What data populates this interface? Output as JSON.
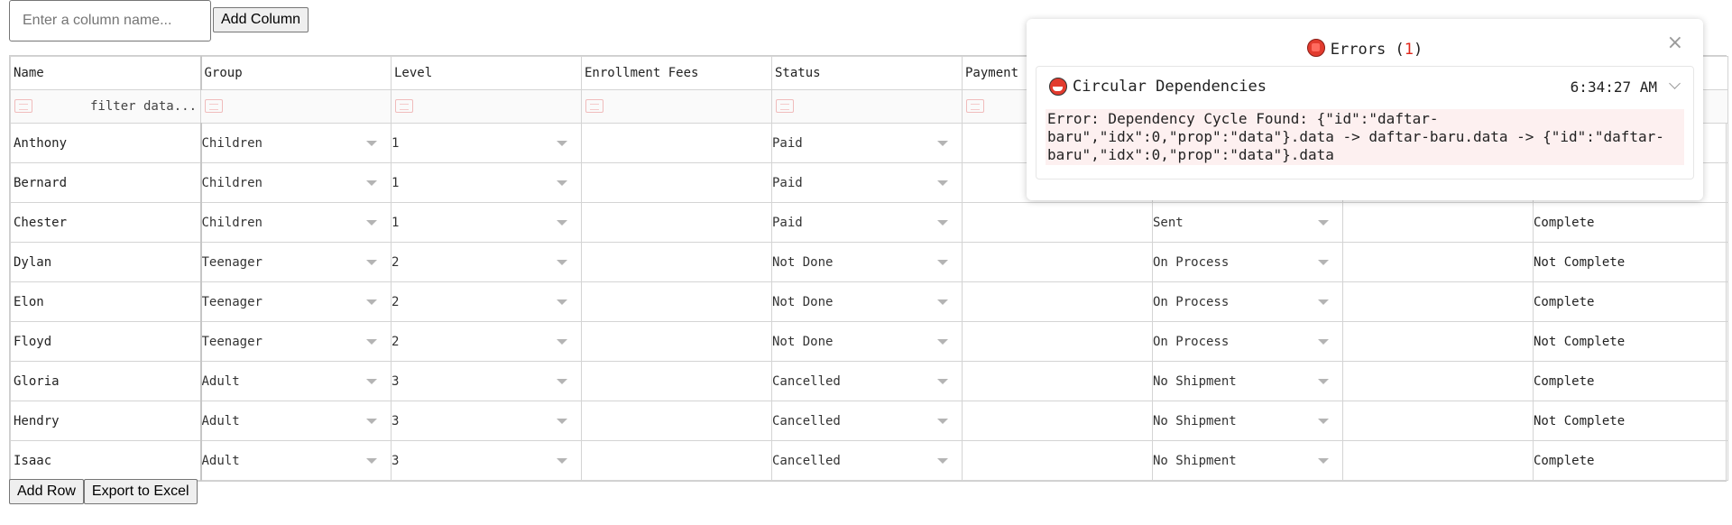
{
  "toolbar": {
    "column_placeholder": "Enter a column name...",
    "add_column_label": "Add Column"
  },
  "grid": {
    "headers": [
      "Name",
      "Group",
      "Level",
      "Enrollment Fees",
      "Status",
      "Payment",
      "",
      "",
      ""
    ],
    "filter_placeholder": "filter data...",
    "rows": [
      {
        "name": "Anthony",
        "group": "Children",
        "level": "1",
        "fees": "",
        "status": "Paid",
        "payment": "",
        "shipment": "",
        "extra": "",
        "result": ""
      },
      {
        "name": "Bernard",
        "group": "Children",
        "level": "1",
        "fees": "",
        "status": "Paid",
        "payment": "",
        "shipment": "",
        "extra": "",
        "result": ""
      },
      {
        "name": "Chester",
        "group": "Children",
        "level": "1",
        "fees": "",
        "status": "Paid",
        "payment": "",
        "shipment": "Sent",
        "extra": "",
        "result": "Complete"
      },
      {
        "name": "Dylan",
        "group": "Teenager",
        "level": "2",
        "fees": "",
        "status": "Not Done",
        "payment": "",
        "shipment": "On Process",
        "extra": "",
        "result": "Not Complete"
      },
      {
        "name": "Elon",
        "group": "Teenager",
        "level": "2",
        "fees": "",
        "status": "Not Done",
        "payment": "",
        "shipment": "On Process",
        "extra": "",
        "result": "Complete"
      },
      {
        "name": "Floyd",
        "group": "Teenager",
        "level": "2",
        "fees": "",
        "status": "Not Done",
        "payment": "",
        "shipment": "On Process",
        "extra": "",
        "result": "Not Complete"
      },
      {
        "name": "Gloria",
        "group": "Adult",
        "level": "3",
        "fees": "",
        "status": "Cancelled",
        "payment": "",
        "shipment": "No Shipment",
        "extra": "",
        "result": "Complete"
      },
      {
        "name": "Hendry",
        "group": "Adult",
        "level": "3",
        "fees": "",
        "status": "Cancelled",
        "payment": "",
        "shipment": "No Shipment",
        "extra": "",
        "result": "Not Complete"
      },
      {
        "name": "Isaac",
        "group": "Adult",
        "level": "3",
        "fees": "",
        "status": "Cancelled",
        "payment": "",
        "shipment": "No Shipment",
        "extra": "",
        "result": "Complete"
      }
    ]
  },
  "footer": {
    "add_row_label": "Add Row",
    "export_label": "Export to Excel"
  },
  "errors": {
    "title": "Errors",
    "count": "1",
    "close_glyph": "×",
    "item": {
      "heading": "Circular Dependencies",
      "time": "6:34:27 AM",
      "message": "Error: Dependency Cycle Found: {\"id\":\"daftar-baru\",\"idx\":0,\"prop\":\"data\"}.data -> daftar-baru.data -> {\"id\":\"daftar-baru\",\"idx\":0,\"prop\":\"data\"}.data"
    }
  },
  "icons": {
    "error_panel_icon": "stop-icon",
    "error_item_icon": "warning-icon",
    "filter_icon": "text-filter-icon",
    "dropdown_icon": "caret-down-icon"
  },
  "colors": {
    "error_red": "#e0261a",
    "message_bg": "#fdf0f0"
  }
}
